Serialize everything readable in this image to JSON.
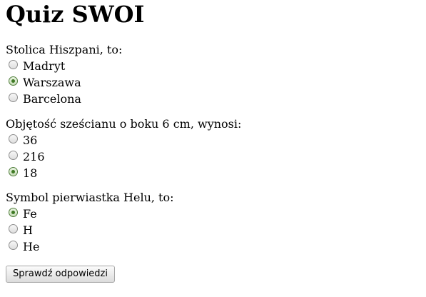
{
  "page": {
    "title": "Quiz SWOI"
  },
  "questions": [
    {
      "text": "Stolica Hiszpani, to:",
      "options": [
        {
          "label": "Madryt",
          "checked": false
        },
        {
          "label": "Warszawa",
          "checked": true
        },
        {
          "label": "Barcelona",
          "checked": false
        }
      ]
    },
    {
      "text": "Objętość sześcianu o boku 6 cm, wynosi:",
      "options": [
        {
          "label": "36",
          "checked": false
        },
        {
          "label": "216",
          "checked": false
        },
        {
          "label": "18",
          "checked": true
        }
      ]
    },
    {
      "text": "Symbol pierwiastka Helu, to:",
      "options": [
        {
          "label": "Fe",
          "checked": true
        },
        {
          "label": "H",
          "checked": false
        },
        {
          "label": "He",
          "checked": false
        }
      ]
    }
  ],
  "form": {
    "submit_label": "Sprawdź odpowiedzi"
  }
}
